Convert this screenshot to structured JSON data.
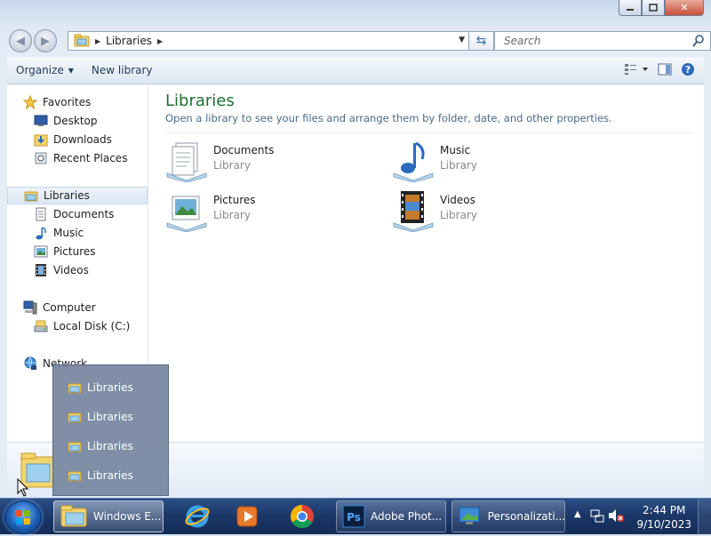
{
  "window": {
    "title_buttons": [
      "minimize",
      "maximize",
      "close"
    ],
    "close_glyph": "✕"
  },
  "address": {
    "crumb": "Libraries",
    "search_placeholder": "Search"
  },
  "toolbar": {
    "organize_label": "Organize",
    "new_library_label": "New library"
  },
  "nav": {
    "favorites": "Favorites",
    "desktop": "Desktop",
    "downloads": "Downloads",
    "recent_places": "Recent Places",
    "libraries": "Libraries",
    "documents": "Documents",
    "music": "Music",
    "pictures": "Pictures",
    "videos": "Videos",
    "computer": "Computer",
    "local_disk": "Local Disk (C:)",
    "network": "Network"
  },
  "main": {
    "title": "Libraries",
    "description": "Open a library to see your files and arrange them by folder, date, and other properties.",
    "libraries": [
      {
        "name": "Documents",
        "type": "Library",
        "icon": "documents-library-icon"
      },
      {
        "name": "Music",
        "type": "Library",
        "icon": "music-library-icon"
      },
      {
        "name": "Pictures",
        "type": "Library",
        "icon": "pictures-library-icon"
      },
      {
        "name": "Videos",
        "type": "Library",
        "icon": "videos-library-icon"
      }
    ]
  },
  "popup": {
    "items": [
      "Libraries",
      "Libraries",
      "Libraries",
      "Libraries"
    ]
  },
  "taskbar": {
    "explorer_label": "Windows E...",
    "photoshop_label": "Adobe Phot...",
    "personalization_label": "Personalizati...",
    "time": "2:44 PM",
    "date": "9/10/2023"
  },
  "colors": {
    "title_green": "#1e6f34",
    "taskbar": "#1c3868",
    "close_red": "#c8503a"
  }
}
